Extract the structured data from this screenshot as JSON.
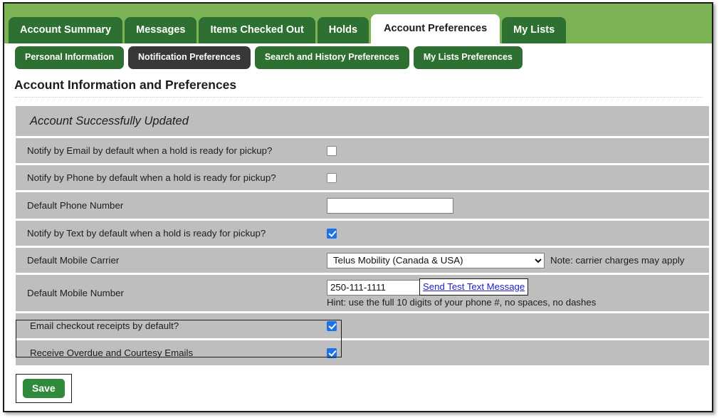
{
  "window": {
    "title": "Account Information and Preferences"
  },
  "primary_tabs": [
    {
      "label": "Account Summary",
      "active": false
    },
    {
      "label": "Messages",
      "active": false
    },
    {
      "label": "Items Checked Out",
      "active": false
    },
    {
      "label": "Holds",
      "active": false
    },
    {
      "label": "Account Preferences",
      "active": true
    },
    {
      "label": "My Lists",
      "active": false
    }
  ],
  "secondary_tabs": [
    {
      "label": "Personal Information",
      "active": false
    },
    {
      "label": "Notification Preferences",
      "active": true
    },
    {
      "label": "Search and History Preferences",
      "active": false
    },
    {
      "label": "My Lists Preferences",
      "active": false
    }
  ],
  "page": {
    "title": "Account Information and Preferences",
    "status_banner": "Account Successfully Updated"
  },
  "preferences": {
    "notify_email": {
      "label": "Notify by Email by default when a hold is ready for pickup?",
      "checked": false
    },
    "notify_phone": {
      "label": "Notify by Phone by default when a hold is ready for pickup?",
      "checked": false
    },
    "default_phone": {
      "label": "Default Phone Number",
      "value": "",
      "placeholder": ""
    },
    "notify_text": {
      "label": "Notify by Text by default when a hold is ready for pickup?",
      "checked": true
    },
    "mobile_carrier": {
      "label": "Default Mobile Carrier",
      "selected": "Telus Mobility (Canada & USA)",
      "options": [
        "Telus Mobility (Canada & USA)"
      ],
      "note": "Note: carrier charges may apply"
    },
    "mobile_number": {
      "label": "Default Mobile Number",
      "value": "250-111-1111",
      "send_test_link": "Send Test Text Message",
      "hint": "Hint: use the full 10 digits of your phone #, no spaces, no dashes"
    },
    "email_receipts": {
      "label": "Email checkout receipts by default?",
      "checked": true
    },
    "overdue_emails": {
      "label": "Receive Overdue and Courtesy Emails",
      "checked": true
    }
  },
  "actions": {
    "save_label": "Save"
  },
  "colors": {
    "header_green": "#7cb354",
    "tab_green": "#2e7031",
    "subtab_active": "#38383a",
    "row_gray": "#bebebe",
    "checkbox_blue": "#1a73e8",
    "link_blue": "#2020cc",
    "save_green": "#2f8a3b"
  }
}
